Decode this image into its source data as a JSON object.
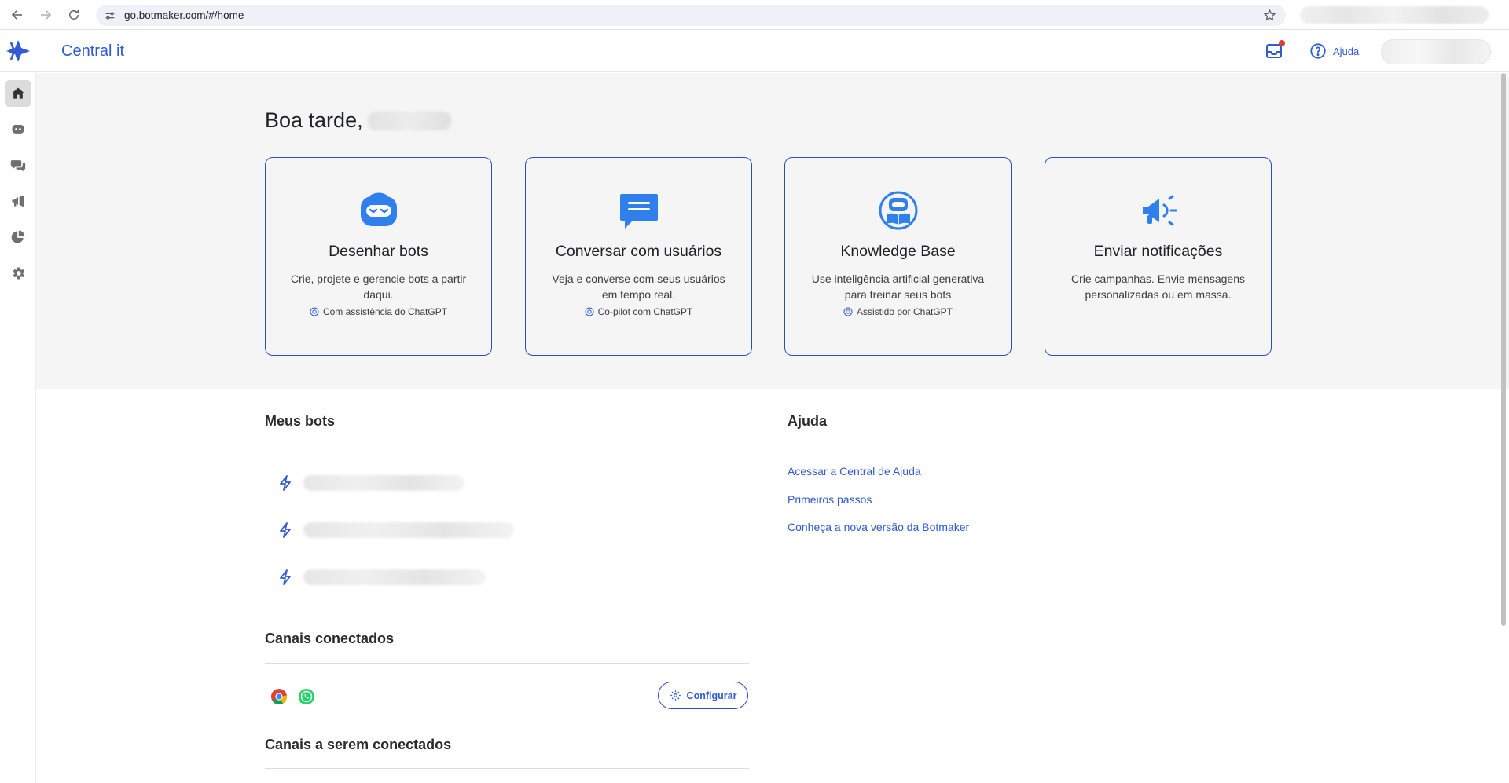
{
  "browser": {
    "url": "go.botmaker.com/#/home",
    "icons": {
      "back": "arrow-left-icon",
      "forward": "arrow-right-icon",
      "reload": "reload-icon",
      "site_info": "tune-icon",
      "bookmark": "star-icon"
    }
  },
  "header": {
    "title": "Central it",
    "help_label": "Ajuda",
    "icons": {
      "logo": "botmaker-logo",
      "inbox": "inbox-icon",
      "help": "help-circle-icon"
    },
    "inbox_notification": true
  },
  "sidebar": {
    "items": [
      {
        "name": "home",
        "icon": "home-icon",
        "active": true
      },
      {
        "name": "bots",
        "icon": "bot-icon",
        "active": false
      },
      {
        "name": "chats",
        "icon": "chat-icon",
        "active": false
      },
      {
        "name": "campaigns",
        "icon": "megaphone-icon",
        "active": false
      },
      {
        "name": "reports",
        "icon": "pie-chart-icon",
        "active": false
      },
      {
        "name": "settings",
        "icon": "gear-icon",
        "active": false
      }
    ]
  },
  "hero": {
    "greeting": "Boa tarde,",
    "cards": [
      {
        "title": "Desenhar bots",
        "description": "Crie, projete e gerencie bots a partir daqui.",
        "badge": "Com assistência do ChatGPT",
        "icon": "bot-face-icon"
      },
      {
        "title": "Conversar com usuários",
        "description": "Veja e converse com seus usuários em tempo real.",
        "badge": "Co-pilot com ChatGPT",
        "icon": "chat-bubble-icon"
      },
      {
        "title": "Knowledge Base",
        "description": "Use inteligência artificial generativa para treinar seus bots",
        "badge": "Assistido por ChatGPT",
        "icon": "bot-book-icon"
      },
      {
        "title": "Enviar notificações",
        "description": "Crie campanhas. Envie mensagens personalizadas ou em massa.",
        "badge": "",
        "icon": "megaphone-icon"
      }
    ]
  },
  "my_bots": {
    "title": "Meus bots",
    "items": [
      {
        "icon": "lightning-icon"
      },
      {
        "icon": "lightning-icon"
      },
      {
        "icon": "lightning-icon"
      }
    ]
  },
  "help_section": {
    "title": "Ajuda",
    "links": [
      "Acessar a Central de Ajuda",
      "Primeiros passos",
      "Conheça a nova versão da Botmaker"
    ]
  },
  "connected_channels": {
    "title": "Canais conectados",
    "channels": [
      "chrome-icon",
      "whatsapp-icon"
    ],
    "configure_label": "Configurar"
  },
  "pending_channels": {
    "title": "Canais a serem conectados"
  },
  "colors": {
    "accent": "#2f5bd3",
    "card_border": "#2f4fb5",
    "hero_background": "#f5f5f5",
    "notification_dot": "#e53935"
  }
}
